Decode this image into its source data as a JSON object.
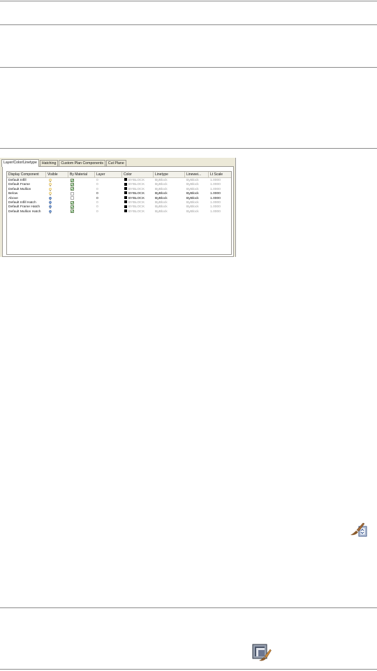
{
  "dialog": {
    "tabs": [
      {
        "label": "Layer/Color/Linetype",
        "active": true
      },
      {
        "label": "Hatching",
        "active": false
      },
      {
        "label": "Custom Plan Components",
        "active": false
      },
      {
        "label": "Cut Plane",
        "active": false
      }
    ],
    "columns": [
      "Display Component",
      "Visible",
      "By Material",
      "Layer",
      "Color",
      "Linetype",
      "Linewei...",
      "Lt Scale"
    ],
    "rows": [
      {
        "component": "Default Infill",
        "visible": "off",
        "by_material": true,
        "layer": "0",
        "color": "BYBLOCK",
        "linetype": "ByBlock",
        "lineweight": "ByBlock",
        "lt_scale": "1.0000",
        "dim": true
      },
      {
        "component": "Default Frame",
        "visible": "off",
        "by_material": true,
        "layer": "0",
        "color": "BYBLOCK",
        "linetype": "ByBlock",
        "lineweight": "ByBlock",
        "lt_scale": "1.0000",
        "dim": true
      },
      {
        "component": "Default Mullion",
        "visible": "off",
        "by_material": true,
        "layer": "0",
        "color": "BYBLOCK",
        "linetype": "ByBlock",
        "lineweight": "ByBlock",
        "lt_scale": "1.0000",
        "dim": true
      },
      {
        "component": "Below",
        "visible": "off",
        "by_material": false,
        "layer": "0",
        "color": "BYBLOCK",
        "linetype": "ByBlock",
        "lineweight": "ByBlock",
        "lt_scale": "1.0000",
        "dim": false
      },
      {
        "component": "Above",
        "visible": "on",
        "by_material": false,
        "layer": "0",
        "color": "BYBLOCK",
        "linetype": "ByBlock",
        "lineweight": "ByBlock",
        "lt_scale": "1.0000",
        "dim": false
      },
      {
        "component": "Default Infill Hatch",
        "visible": "on",
        "by_material": true,
        "layer": "0",
        "color": "BYBLOCK",
        "linetype": "ByBlock",
        "lineweight": "ByBlock",
        "lt_scale": "1.0000",
        "dim": true
      },
      {
        "component": "Default Frame Hatch",
        "visible": "on",
        "by_material": true,
        "layer": "0",
        "color": "BYBLOCK",
        "linetype": "ByBlock",
        "lineweight": "ByBlock",
        "lt_scale": "1.0000",
        "dim": true
      },
      {
        "component": "Default Mullion Hatch",
        "visible": "on",
        "by_material": true,
        "layer": "0",
        "color": "BYBLOCK",
        "linetype": "ByBlock",
        "lineweight": "ByBlock",
        "lt_scale": "1.0000",
        "dim": true
      }
    ]
  },
  "icons": {
    "display_properties": "brush-display-icon",
    "style_editor": "edit-style-brush-icon"
  },
  "colors": {
    "rule": "#8a8a8a",
    "dialog_bg": "#ece9d8",
    "dim_text": "#9c9c9c",
    "bulb_on": "#7aa0d8",
    "bulb_off": "#e0b23a",
    "check_green": "#2e8b2e"
  }
}
